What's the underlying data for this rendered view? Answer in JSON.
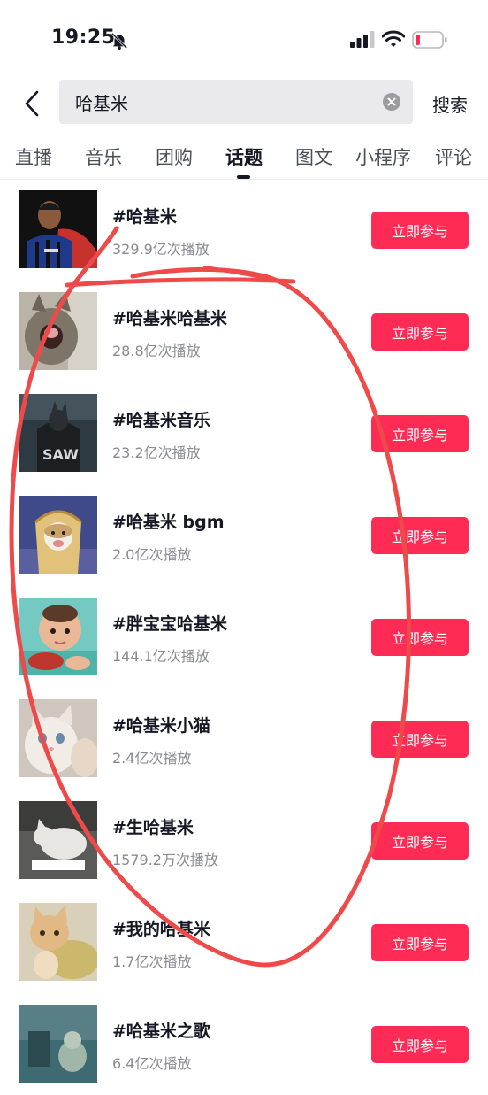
{
  "status_bar": {
    "time": "19:25",
    "bell_icon": "bell-slash-icon",
    "battery_color": "#fe2c55"
  },
  "search": {
    "query": "哈基米",
    "button_label": "搜索"
  },
  "tabs": [
    {
      "label": "直播"
    },
    {
      "label": "音乐"
    },
    {
      "label": "团购"
    },
    {
      "label": "话题",
      "active": true
    },
    {
      "label": "图文"
    },
    {
      "label": "小程序"
    },
    {
      "label": "评论"
    }
  ],
  "topics": [
    {
      "title": "#哈基米",
      "plays": "329.9亿次播放",
      "button": "立即参与"
    },
    {
      "title": "#哈基米哈基米",
      "plays": "28.8亿次播放",
      "button": "立即参与"
    },
    {
      "title": "#哈基米音乐",
      "plays": "23.2亿次播放",
      "button": "立即参与"
    },
    {
      "title": "#哈基米 bgm",
      "plays": "2.0亿次播放",
      "button": "立即参与"
    },
    {
      "title": "#胖宝宝哈基米",
      "plays": "144.1亿次播放",
      "button": "立即参与"
    },
    {
      "title": "#哈基米小猫",
      "plays": "2.4亿次播放",
      "button": "立即参与"
    },
    {
      "title": "#生哈基米",
      "plays": "1579.2万次播放",
      "button": "立即参与"
    },
    {
      "title": "#我的哈基米",
      "plays": "1.7亿次播放",
      "button": "立即参与"
    },
    {
      "title": "#哈基米之歌",
      "plays": "6.4亿次播放",
      "button": "立即参与"
    }
  ],
  "colors": {
    "accent": "#fe2c55",
    "annotation": "#ee4a4a"
  }
}
